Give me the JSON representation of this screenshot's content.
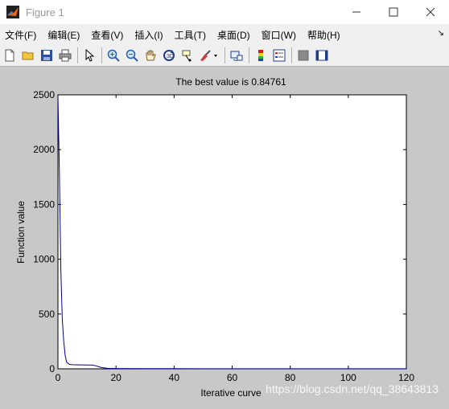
{
  "window": {
    "title": "Figure 1"
  },
  "menubar": {
    "items": [
      {
        "label": "文件(F)"
      },
      {
        "label": "编辑(E)"
      },
      {
        "label": "查看(V)"
      },
      {
        "label": "插入(I)"
      },
      {
        "label": "工具(T)"
      },
      {
        "label": "桌面(D)"
      },
      {
        "label": "窗口(W)"
      },
      {
        "label": "帮助(H)"
      }
    ],
    "overflow_arrow": "↘"
  },
  "toolbar": {
    "icons": [
      "new-figure-icon",
      "open-icon",
      "save-icon",
      "print-icon",
      "pointer-icon",
      "zoom-in-icon",
      "zoom-out-icon",
      "pan-icon",
      "rotate-icon",
      "data-cursor-icon",
      "brush-icon",
      "link-icon",
      "colorbar-icon",
      "legend-icon",
      "hide-plot-tools-icon",
      "show-plot-tools-icon"
    ]
  },
  "chart_data": {
    "type": "line",
    "title": "The best value is 0.84761",
    "xlabel": "Iterative curve",
    "ylabel": "Function value",
    "xlim": [
      0,
      120
    ],
    "ylim": [
      0,
      2500
    ],
    "xticks": [
      "0",
      "20",
      "40",
      "60",
      "80",
      "100",
      "120"
    ],
    "yticks": [
      "0",
      "500",
      "1000",
      "1500",
      "2000",
      "2500"
    ],
    "grid": false,
    "series": [
      {
        "color": "#00008b",
        "x": [
          0,
          0.5,
          1,
          1.5,
          2,
          2.5,
          3,
          4,
          5,
          6,
          8,
          10,
          12,
          13,
          14,
          15,
          16,
          17,
          20,
          30,
          40,
          60,
          80,
          100,
          120
        ],
        "y": [
          2480,
          1800,
          900,
          450,
          250,
          120,
          60,
          40,
          38,
          37,
          36,
          35,
          34,
          28,
          20,
          12,
          8,
          5,
          3,
          2,
          1.5,
          1.2,
          1,
          0.9,
          0.85
        ]
      }
    ]
  },
  "watermark": "https://blog.csdn.net/qq_38643813"
}
